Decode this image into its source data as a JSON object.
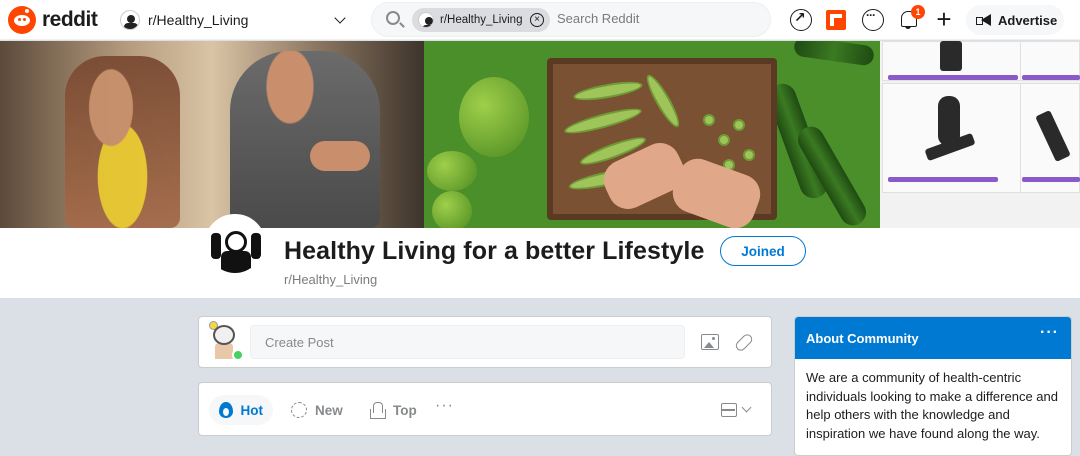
{
  "header": {
    "logo_text": "reddit",
    "community_switcher": "r/Healthy_Living",
    "search": {
      "chip_label": "r/Healthy_Living",
      "placeholder": "Search Reddit"
    },
    "notification_count": "1",
    "advertise_label": "Advertise",
    "icons": [
      "popular-icon",
      "coins-icon",
      "chat-icon",
      "notification-bell-icon",
      "create-plus-icon",
      "megaphone-icon"
    ]
  },
  "community": {
    "title": "Healthy Living for a better Lifestyle",
    "name": "r/Healthy_Living",
    "join_label": "Joined"
  },
  "create_post": {
    "placeholder": "Create Post"
  },
  "sort": {
    "hot": "Hot",
    "new": "New",
    "top": "Top",
    "more": "···"
  },
  "about": {
    "title": "About Community",
    "more": "···",
    "description": "We are a community of health-centric individuals looking to make a difference and help others with the knowledge and inspiration we have found along the way."
  },
  "colors": {
    "brand": "#ff4500",
    "accent": "#0079d3",
    "online": "#46d160"
  }
}
